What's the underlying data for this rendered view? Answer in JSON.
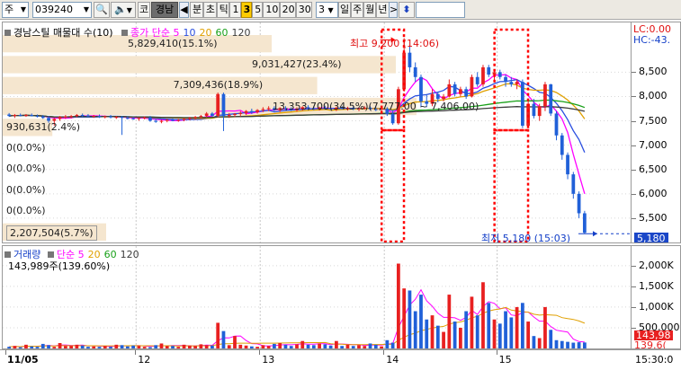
{
  "toolbar": {
    "market_code": "주",
    "stock_code": "039240",
    "stock_name": "경남",
    "stock_prefix": "코",
    "timeframes": [
      "분",
      "초",
      "틱",
      "1",
      "3",
      "5",
      "10",
      "20",
      "30"
    ],
    "selected_timeframe": "3",
    "period_value": "3",
    "periods": [
      "일",
      "주",
      "월",
      "년"
    ],
    "up_down_glyph": "⬍"
  },
  "main": {
    "legend": {
      "title": "경남스틸 매물대 수(10)",
      "ma_prefix": "종가 단순",
      "ma_periods": [
        "5",
        "10",
        "20",
        "60",
        "120"
      ],
      "ma_colors": [
        "#ff00ff",
        "#2a4ee0",
        "#e0a000",
        "#18a018",
        "#3b3b3b"
      ]
    },
    "top_right": {
      "lc": "LC:0.00",
      "hc": "HC:-43."
    },
    "price_axis": [
      "8,500",
      "8,000",
      "7,500",
      "7,000",
      "6,500",
      "6,000",
      "5,500"
    ],
    "current_price_tag": "5,180",
    "volume_profile": [
      {
        "label": "5,829,410(15.1%)",
        "frac": 0.65
      },
      {
        "label": "9,031,427(23.4%)",
        "frac": 0.95
      },
      {
        "label": "7,309,436(18.9%)",
        "frac": 0.76
      },
      {
        "label": "13,353,700(34.5%)(7,777.00 ~ 7,406.00)",
        "frac": 1.0
      },
      {
        "label": "930,631(2.4%)",
        "frac": 0.12
      },
      {
        "label": "0(0.0%)",
        "frac": 0
      },
      {
        "label": "0(0.0%)",
        "frac": 0
      },
      {
        "label": "0(0.0%)",
        "frac": 0
      },
      {
        "label": "0(0.0%)",
        "frac": 0
      },
      {
        "label": "2,207,504(5.7%)",
        "frac": 0.25
      }
    ],
    "high_label": "최고 9,200 (14:06)",
    "low_label": "최저 5,180 (15:03)"
  },
  "volume": {
    "legend": {
      "title": "거래량",
      "ma_prefix": "단순",
      "ma_periods": [
        "5",
        "20",
        "60",
        "120"
      ],
      "ma_colors": [
        "#ff00ff",
        "#e0a000",
        "#18a018",
        "#3b3b3b"
      ]
    },
    "current_volume": "143,989주(139.60%)",
    "axis": [
      "2,000K",
      "1,500K",
      "1,000K",
      "500,000"
    ],
    "axis_tags": [
      "143,98",
      "139.6("
    ]
  },
  "dates": {
    "labels": [
      "11/05",
      "12",
      "13",
      "14",
      "15"
    ],
    "time_label": "15:30:0"
  },
  "colors": {
    "up": "#e82020",
    "down": "#2060d8",
    "accent": "#ff0000"
  },
  "chart_data": {
    "type": "candlestick",
    "price_ylim": [
      5000,
      9300
    ],
    "volume_ylim": [
      0,
      2300
    ],
    "volume_unit": "K",
    "candles": [
      {
        "o": 7630,
        "h": 7660,
        "l": 7580,
        "c": 7600,
        "v": 40
      },
      {
        "o": 7600,
        "h": 7640,
        "l": 7560,
        "c": 7620,
        "v": 60
      },
      {
        "o": 7620,
        "h": 7650,
        "l": 7590,
        "c": 7610,
        "v": 30
      },
      {
        "o": 7610,
        "h": 7640,
        "l": 7580,
        "c": 7620,
        "v": 90
      },
      {
        "o": 7620,
        "h": 7650,
        "l": 7590,
        "c": 7600,
        "v": 50
      },
      {
        "o": 7600,
        "h": 7630,
        "l": 7570,
        "c": 7590,
        "v": 40
      },
      {
        "o": 7590,
        "h": 7620,
        "l": 7540,
        "c": 7560,
        "v": 110
      },
      {
        "o": 7560,
        "h": 7600,
        "l": 7460,
        "c": 7500,
        "v": 80
      },
      {
        "o": 7500,
        "h": 7560,
        "l": 7400,
        "c": 7540,
        "v": 40
      },
      {
        "o": 7540,
        "h": 7600,
        "l": 7500,
        "c": 7580,
        "v": 130
      },
      {
        "o": 7580,
        "h": 7620,
        "l": 7540,
        "c": 7590,
        "v": 60
      },
      {
        "o": 7590,
        "h": 7620,
        "l": 7550,
        "c": 7600,
        "v": 60
      },
      {
        "o": 7600,
        "h": 7640,
        "l": 7570,
        "c": 7620,
        "v": 90
      },
      {
        "o": 7620,
        "h": 7650,
        "l": 7580,
        "c": 7610,
        "v": 70
      },
      {
        "o": 7610,
        "h": 7640,
        "l": 7580,
        "c": 7590,
        "v": 40
      },
      {
        "o": 7590,
        "h": 7620,
        "l": 7560,
        "c": 7600,
        "v": 50
      },
      {
        "o": 7600,
        "h": 7630,
        "l": 7560,
        "c": 7580,
        "v": 40
      },
      {
        "o": 7580,
        "h": 7610,
        "l": 7550,
        "c": 7590,
        "v": 60
      },
      {
        "o": 7590,
        "h": 7620,
        "l": 7550,
        "c": 7570,
        "v": 40
      },
      {
        "o": 7570,
        "h": 7600,
        "l": 7540,
        "c": 7580,
        "v": 90
      },
      {
        "o": 7580,
        "h": 7600,
        "l": 7210,
        "c": 7560,
        "v": 80
      },
      {
        "o": 7560,
        "h": 7590,
        "l": 7530,
        "c": 7550,
        "v": 50
      },
      {
        "o": 7550,
        "h": 7580,
        "l": 7520,
        "c": 7540,
        "v": 70
      },
      {
        "o": 7540,
        "h": 7570,
        "l": 7500,
        "c": 7560,
        "v": 60
      },
      {
        "o": 7560,
        "h": 7590,
        "l": 7530,
        "c": 7570,
        "v": 40
      },
      {
        "o": 7570,
        "h": 7600,
        "l": 7480,
        "c": 7500,
        "v": 30
      },
      {
        "o": 7500,
        "h": 7530,
        "l": 7460,
        "c": 7480,
        "v": 80
      },
      {
        "o": 7480,
        "h": 7520,
        "l": 7450,
        "c": 7500,
        "v": 120
      },
      {
        "o": 7500,
        "h": 7540,
        "l": 7470,
        "c": 7520,
        "v": 60
      },
      {
        "o": 7520,
        "h": 7550,
        "l": 7490,
        "c": 7510,
        "v": 60
      },
      {
        "o": 7510,
        "h": 7540,
        "l": 7480,
        "c": 7520,
        "v": 40
      },
      {
        "o": 7520,
        "h": 7560,
        "l": 7490,
        "c": 7540,
        "v": 90
      },
      {
        "o": 7540,
        "h": 7580,
        "l": 7510,
        "c": 7560,
        "v": 70
      },
      {
        "o": 7560,
        "h": 7600,
        "l": 7520,
        "c": 7580,
        "v": 60
      },
      {
        "o": 7580,
        "h": 7620,
        "l": 7550,
        "c": 7600,
        "v": 100
      },
      {
        "o": 7600,
        "h": 7680,
        "l": 7570,
        "c": 7650,
        "v": 80
      },
      {
        "o": 7650,
        "h": 7680,
        "l": 7590,
        "c": 7600,
        "v": 70
      },
      {
        "o": 7600,
        "h": 8080,
        "l": 7570,
        "c": 8050,
        "v": 620
      },
      {
        "o": 8050,
        "h": 8080,
        "l": 7290,
        "c": 7600,
        "v": 420
      },
      {
        "o": 7600,
        "h": 7660,
        "l": 7560,
        "c": 7620,
        "v": 80
      },
      {
        "o": 7620,
        "h": 7660,
        "l": 7580,
        "c": 7640,
        "v": 300
      },
      {
        "o": 7640,
        "h": 7700,
        "l": 7590,
        "c": 7660,
        "v": 90
      },
      {
        "o": 7660,
        "h": 7720,
        "l": 7620,
        "c": 7700,
        "v": 70
      },
      {
        "o": 7700,
        "h": 7750,
        "l": 7640,
        "c": 7680,
        "v": 50
      },
      {
        "o": 7680,
        "h": 7740,
        "l": 7650,
        "c": 7720,
        "v": 40
      },
      {
        "o": 7720,
        "h": 7780,
        "l": 7680,
        "c": 7740,
        "v": 80
      },
      {
        "o": 7740,
        "h": 7800,
        "l": 7700,
        "c": 7760,
        "v": 60
      },
      {
        "o": 7760,
        "h": 7800,
        "l": 7700,
        "c": 7720,
        "v": 110
      },
      {
        "o": 7720,
        "h": 7780,
        "l": 7680,
        "c": 7760,
        "v": 130
      },
      {
        "o": 7760,
        "h": 7800,
        "l": 7720,
        "c": 7740,
        "v": 90
      },
      {
        "o": 7740,
        "h": 7780,
        "l": 7700,
        "c": 7720,
        "v": 60
      },
      {
        "o": 7720,
        "h": 7780,
        "l": 7690,
        "c": 7740,
        "v": 100
      },
      {
        "o": 7740,
        "h": 7800,
        "l": 7710,
        "c": 7780,
        "v": 180
      },
      {
        "o": 7780,
        "h": 7820,
        "l": 7730,
        "c": 7760,
        "v": 90
      },
      {
        "o": 7760,
        "h": 7800,
        "l": 7720,
        "c": 7750,
        "v": 80
      },
      {
        "o": 7750,
        "h": 7790,
        "l": 7710,
        "c": 7770,
        "v": 120
      },
      {
        "o": 7770,
        "h": 7810,
        "l": 7730,
        "c": 7760,
        "v": 100
      },
      {
        "o": 7760,
        "h": 7800,
        "l": 7720,
        "c": 7740,
        "v": 70
      },
      {
        "o": 7740,
        "h": 7790,
        "l": 7700,
        "c": 7770,
        "v": 180
      },
      {
        "o": 7770,
        "h": 7800,
        "l": 7730,
        "c": 7750,
        "v": 60
      },
      {
        "o": 7750,
        "h": 7790,
        "l": 7710,
        "c": 7760,
        "v": 90
      },
      {
        "o": 7760,
        "h": 7800,
        "l": 7720,
        "c": 7740,
        "v": 60
      },
      {
        "o": 7740,
        "h": 7780,
        "l": 7700,
        "c": 7760,
        "v": 80
      },
      {
        "o": 7760,
        "h": 7800,
        "l": 7730,
        "c": 7770,
        "v": 60
      },
      {
        "o": 7770,
        "h": 7800,
        "l": 7720,
        "c": 7740,
        "v": 120
      },
      {
        "o": 7740,
        "h": 7780,
        "l": 7700,
        "c": 7730,
        "v": 90
      },
      {
        "o": 7730,
        "h": 7770,
        "l": 7690,
        "c": 7750,
        "v": 50
      },
      {
        "o": 7750,
        "h": 7780,
        "l": 7600,
        "c": 7640,
        "v": 200
      },
      {
        "o": 7640,
        "h": 7700,
        "l": 7420,
        "c": 7450,
        "v": 140
      },
      {
        "o": 7450,
        "h": 8200,
        "l": 7420,
        "c": 8150,
        "v": 2050
      },
      {
        "o": 8150,
        "h": 9200,
        "l": 8100,
        "c": 8900,
        "v": 1450
      },
      {
        "o": 8900,
        "h": 9050,
        "l": 8500,
        "c": 8600,
        "v": 1400
      },
      {
        "o": 8600,
        "h": 8700,
        "l": 8300,
        "c": 8400,
        "v": 900
      },
      {
        "o": 8400,
        "h": 8450,
        "l": 7780,
        "c": 7900,
        "v": 1300
      },
      {
        "o": 7900,
        "h": 8050,
        "l": 7780,
        "c": 7850,
        "v": 700
      },
      {
        "o": 7850,
        "h": 8150,
        "l": 7800,
        "c": 8050,
        "v": 800
      },
      {
        "o": 8050,
        "h": 8100,
        "l": 7880,
        "c": 7950,
        "v": 550
      },
      {
        "o": 7950,
        "h": 8050,
        "l": 7900,
        "c": 8000,
        "v": 400
      },
      {
        "o": 8000,
        "h": 8350,
        "l": 7980,
        "c": 8250,
        "v": 1300
      },
      {
        "o": 8250,
        "h": 8300,
        "l": 8000,
        "c": 8050,
        "v": 650
      },
      {
        "o": 8050,
        "h": 8200,
        "l": 8000,
        "c": 8150,
        "v": 500
      },
      {
        "o": 8150,
        "h": 8200,
        "l": 7950,
        "c": 8000,
        "v": 900
      },
      {
        "o": 8000,
        "h": 8450,
        "l": 7980,
        "c": 8400,
        "v": 1250
      },
      {
        "o": 8400,
        "h": 8500,
        "l": 8200,
        "c": 8250,
        "v": 800
      },
      {
        "o": 8250,
        "h": 8650,
        "l": 8200,
        "c": 8600,
        "v": 1600
      },
      {
        "o": 8600,
        "h": 8650,
        "l": 8400,
        "c": 8450,
        "v": 1100
      },
      {
        "o": 8450,
        "h": 8550,
        "l": 8300,
        "c": 8500,
        "v": 700
      },
      {
        "o": 8500,
        "h": 8550,
        "l": 8350,
        "c": 8400,
        "v": 600
      },
      {
        "o": 8400,
        "h": 8450,
        "l": 8200,
        "c": 8300,
        "v": 900
      },
      {
        "o": 8300,
        "h": 8400,
        "l": 8200,
        "c": 8250,
        "v": 750
      },
      {
        "o": 8250,
        "h": 8350,
        "l": 8150,
        "c": 8300,
        "v": 1000
      },
      {
        "o": 8300,
        "h": 8350,
        "l": 7350,
        "c": 7400,
        "v": 1100
      },
      {
        "o": 7400,
        "h": 7900,
        "l": 7350,
        "c": 7850,
        "v": 650
      },
      {
        "o": 7850,
        "h": 7950,
        "l": 7550,
        "c": 7600,
        "v": 300
      },
      {
        "o": 7600,
        "h": 7850,
        "l": 7500,
        "c": 7800,
        "v": 250
      },
      {
        "o": 7800,
        "h": 8300,
        "l": 7700,
        "c": 8250,
        "v": 1000
      },
      {
        "o": 8250,
        "h": 8260,
        "l": 7600,
        "c": 7650,
        "v": 450
      },
      {
        "o": 7650,
        "h": 7700,
        "l": 7100,
        "c": 7200,
        "v": 200
      },
      {
        "o": 7200,
        "h": 7250,
        "l": 6700,
        "c": 6800,
        "v": 180
      },
      {
        "o": 6800,
        "h": 6850,
        "l": 6300,
        "c": 6400,
        "v": 160
      },
      {
        "o": 6400,
        "h": 6450,
        "l": 5900,
        "c": 6000,
        "v": 140
      },
      {
        "o": 6000,
        "h": 6050,
        "l": 5500,
        "c": 5600,
        "v": 150
      },
      {
        "o": 5600,
        "h": 5650,
        "l": 5180,
        "c": 5200,
        "v": 144
      }
    ],
    "highlight_ranges": [
      [
        67,
        69
      ],
      [
        87,
        91
      ]
    ],
    "high": {
      "price": 9200,
      "index": 68
    },
    "low": {
      "price": 5180,
      "index": 98
    },
    "day_starts": [
      0,
      23,
      45,
      67,
      87
    ],
    "price_ticks": [
      8500,
      8000,
      7500,
      7000,
      6500,
      6000,
      5500
    ],
    "volume_ticks": [
      2000,
      1500,
      1000,
      500
    ]
  }
}
